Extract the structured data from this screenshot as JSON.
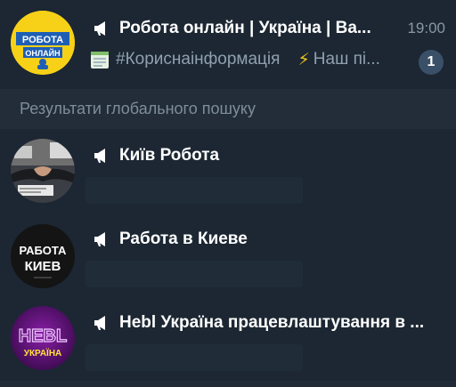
{
  "chats": [
    {
      "title": "Робота онлайн | Україна | Ва...",
      "time": "19:00",
      "preview_emoji": "⚡",
      "preview_hashtag": "#Кориснаінформація",
      "preview_text": "Наш пі...",
      "unread_count": "1",
      "avatar_lines": [
        "РОБОТА",
        "ОНЛАЙН"
      ]
    }
  ],
  "global_search": {
    "section_title": "Результати глобального пошуку",
    "results": [
      {
        "title": "Київ Робота"
      },
      {
        "title": "Работа в Киеве",
        "avatar_lines": [
          "РАБОТА",
          "КИЕВ"
        ]
      },
      {
        "title": "Hebl Україна працевлаштування в ...",
        "avatar_lines": [
          "HEBL",
          "УКРАЇНА"
        ]
      }
    ]
  },
  "colors": {
    "background": "#1c2733",
    "section_background": "#222d39",
    "badge": "#3a5068",
    "muted_text": "#8a97a4"
  },
  "icons": [
    "megaphone-icon",
    "notepad-icon",
    "lightning-icon"
  ]
}
